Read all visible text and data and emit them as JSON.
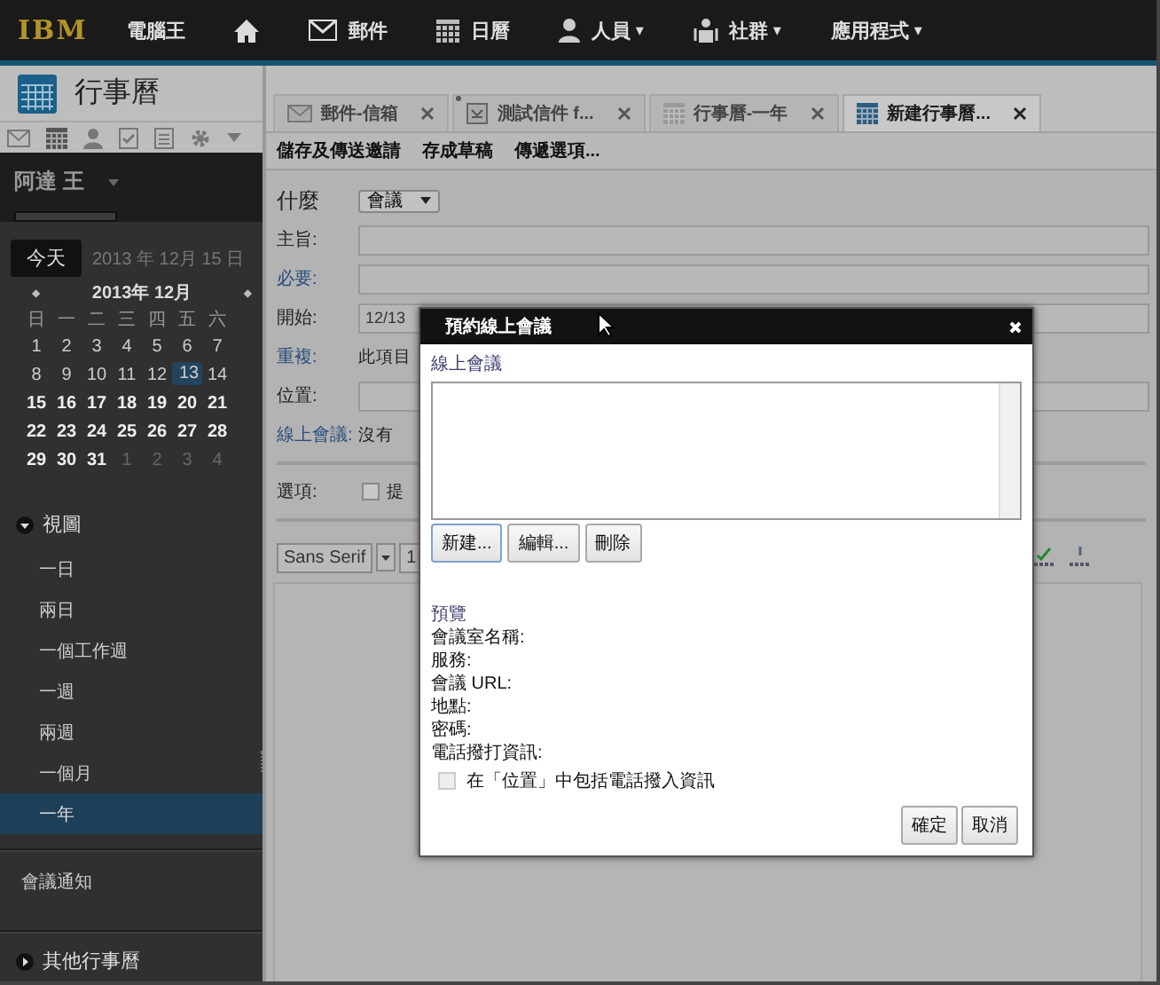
{
  "topbar": {
    "logo": "IBM",
    "items": [
      {
        "kind": "text",
        "label": "電腦王"
      },
      {
        "kind": "home"
      },
      {
        "kind": "mail",
        "label": "郵件"
      },
      {
        "kind": "calendar",
        "label": "日曆"
      },
      {
        "kind": "person",
        "label": "人員",
        "caret": "▾"
      },
      {
        "kind": "community",
        "label": "社群",
        "caret": "▾"
      },
      {
        "kind": "text",
        "label": "應用程式",
        "caret": "▾"
      }
    ]
  },
  "app_title": "行事曆",
  "tabs": [
    {
      "kind": "mail",
      "label": "郵件-信箱",
      "modified": false,
      "selected": false
    },
    {
      "kind": "draft",
      "label": "測試信件 f...",
      "modified": true,
      "selected": false
    },
    {
      "kind": "calendar",
      "label": "行事曆-一年",
      "modified": false,
      "selected": false
    },
    {
      "kind": "newcal",
      "label": "新建行事曆...",
      "modified": false,
      "selected": true
    }
  ],
  "sidebar": {
    "user": "阿達 王",
    "today_button": "今天",
    "today_date": "2013 年 12月 15 日",
    "prev": "◆",
    "next": "◆",
    "month": "2013年  12月",
    "weekdays": [
      "日",
      "一",
      "二",
      "三",
      "四",
      "五",
      "六"
    ],
    "days": [
      {
        "d": "1",
        "muted": false,
        "selected": false
      },
      {
        "d": "2",
        "muted": false,
        "selected": false
      },
      {
        "d": "3",
        "muted": false,
        "selected": false
      },
      {
        "d": "4",
        "muted": false,
        "selected": false
      },
      {
        "d": "5",
        "muted": false,
        "selected": false
      },
      {
        "d": "6",
        "muted": false,
        "selected": false
      },
      {
        "d": "7",
        "muted": false,
        "selected": false
      },
      {
        "d": "8",
        "muted": false,
        "selected": false
      },
      {
        "d": "9",
        "muted": false,
        "selected": false
      },
      {
        "d": "10",
        "muted": false,
        "selected": false
      },
      {
        "d": "11",
        "muted": false,
        "selected": false
      },
      {
        "d": "12",
        "muted": false,
        "selected": false
      },
      {
        "d": "13",
        "muted": false,
        "selected": true
      },
      {
        "d": "14",
        "muted": false,
        "selected": false
      },
      {
        "d": "15",
        "muted": false,
        "selected": false
      },
      {
        "d": "16",
        "muted": false,
        "selected": false
      },
      {
        "d": "17",
        "muted": false,
        "selected": false
      },
      {
        "d": "18",
        "muted": false,
        "selected": false
      },
      {
        "d": "19",
        "muted": false,
        "selected": false
      },
      {
        "d": "20",
        "muted": false,
        "selected": false
      },
      {
        "d": "21",
        "muted": false,
        "selected": false
      },
      {
        "d": "22",
        "muted": false,
        "selected": false
      },
      {
        "d": "23",
        "muted": false,
        "selected": false
      },
      {
        "d": "24",
        "muted": false,
        "selected": false
      },
      {
        "d": "25",
        "muted": false,
        "selected": false
      },
      {
        "d": "26",
        "muted": false,
        "selected": false
      },
      {
        "d": "27",
        "muted": false,
        "selected": false
      },
      {
        "d": "28",
        "muted": false,
        "selected": false
      },
      {
        "d": "29",
        "muted": false,
        "selected": false
      },
      {
        "d": "30",
        "muted": false,
        "selected": false
      },
      {
        "d": "31",
        "muted": false,
        "selected": false
      },
      {
        "d": "1",
        "muted": true,
        "selected": false
      },
      {
        "d": "2",
        "muted": true,
        "selected": false
      },
      {
        "d": "3",
        "muted": true,
        "selected": false
      },
      {
        "d": "4",
        "muted": true,
        "selected": false
      }
    ],
    "views": {
      "label": "視圖",
      "expanded": true,
      "items": [
        {
          "label": "一日",
          "selected": false
        },
        {
          "label": "兩日",
          "selected": false
        },
        {
          "label": "一個工作週",
          "selected": false
        },
        {
          "label": "一週",
          "selected": false
        },
        {
          "label": "兩週",
          "selected": false
        },
        {
          "label": "一個月",
          "selected": false
        },
        {
          "label": "一年",
          "selected": true
        }
      ]
    },
    "notices": "會議通知",
    "others": {
      "label": "其他行事曆",
      "expanded": false
    }
  },
  "actions": [
    "儲存及傳送邀請",
    "存成草稿",
    "傳遞選項..."
  ],
  "form": [
    {
      "kind": "select",
      "label": "什麼",
      "value": "會議",
      "link": false
    },
    {
      "kind": "field",
      "label": "主旨:",
      "link": false
    },
    {
      "kind": "field",
      "label": "必要:",
      "link": true
    },
    {
      "kind": "field",
      "label": "開始:",
      "value": "12/13",
      "link": false
    },
    {
      "kind": "text",
      "label": "重複:",
      "value": "此項目",
      "link": true
    },
    {
      "kind": "field",
      "label": "位置:",
      "link": false
    },
    {
      "kind": "text",
      "label": "線上會議:",
      "value": "沒有",
      "link": true
    }
  ],
  "options": {
    "label": "選項:",
    "check": "提",
    "checked": false
  },
  "editor": {
    "font": "Sans Serif",
    "size": "1"
  },
  "dialog": {
    "title": "預約線上會議",
    "section": "線上會議",
    "buttons": [
      "新建...",
      "編輯...",
      "刪除"
    ],
    "preview_title": "預覽",
    "preview": [
      "會議室名稱:",
      "服務:",
      "會議 URL:",
      "地點:",
      "密碼:",
      "電話撥打資訊:"
    ],
    "include": {
      "label": "在「位置」中包括電話撥入資訊",
      "checked": false,
      "disabled": true
    },
    "footer": [
      "確定",
      "取消"
    ]
  }
}
